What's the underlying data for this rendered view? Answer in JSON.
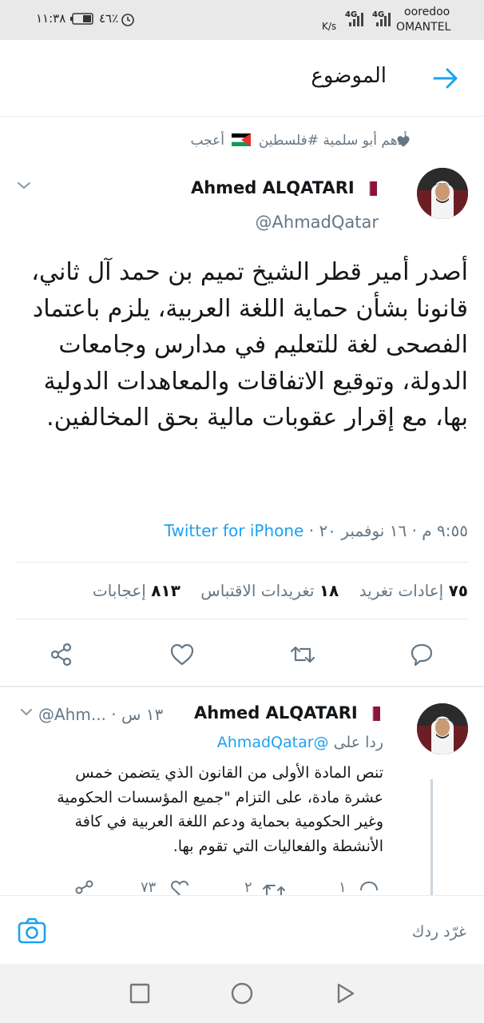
{
  "status_bar": {
    "carrier_line1": "ooredoo",
    "carrier_line2": "OMANTEL",
    "speed_unit": "K/s",
    "net1": "4G",
    "net2": "4G",
    "time": "١١:٣٨",
    "battery": "٤٦٪"
  },
  "header": {
    "title": "الموضوع"
  },
  "liked_by": {
    "text_before_flag": "أدهم أبو سلمية #فلسطين",
    "text_after_flag": "أعجب"
  },
  "main_tweet": {
    "author_name": "Ahmed ALQATARI",
    "handle": "@AhmadQatar",
    "text": "أصدر أمير قطر الشيخ تميم بن حمد آل ثاني، قانونا بشأن حماية اللغة العربية، يلزم باعتماد الفصحى لغة للتعليم في مدارس وجامعات الدولة، وتوقيع الاتفاقات والمعاهدات الدولية بها، مع إقرار عقوبات مالية بحق المخالفين.",
    "timestamp": "٩:٥٥ م · ١٦ نوفمبر ٢٠ ·",
    "source": "Twitter for iPhone",
    "stats": {
      "retweets_count": "٧٥",
      "retweets_label": "إعادات تغريد",
      "quotes_count": "١٨",
      "quotes_label": "تغريدات الاقتباس",
      "likes_count": "٨١٣",
      "likes_label": "إعجابات"
    }
  },
  "reply_tweet": {
    "author_name": "Ahmed ALQATARI",
    "handle_time": "@Ahm... · ١٣ س",
    "replying_label": "ردا على",
    "replying_handle": "@AhmadQatar",
    "text": "تنص المادة الأولى من القانون الذي يتضمن خمس عشرة مادة، على التزام \"جميع المؤسسات الحكومية وغير الحكومية بحماية ودعم اللغة العربية في كافة الأنشطة والفعاليات التي تقوم بها.",
    "replies": "١",
    "retweets": "٢",
    "likes": "٧٣"
  },
  "compose": {
    "placeholder": "غرّد ردك"
  },
  "colors": {
    "accent": "#1da1f2",
    "muted": "#657786",
    "divider": "#e6ecf0"
  },
  "icons": [
    "back-arrow-icon",
    "heart-icon",
    "chevron-down-icon",
    "reply-icon",
    "retweet-icon",
    "like-icon",
    "share-icon",
    "camera-icon",
    "square-nav-icon",
    "circle-nav-icon",
    "triangle-nav-icon"
  ]
}
